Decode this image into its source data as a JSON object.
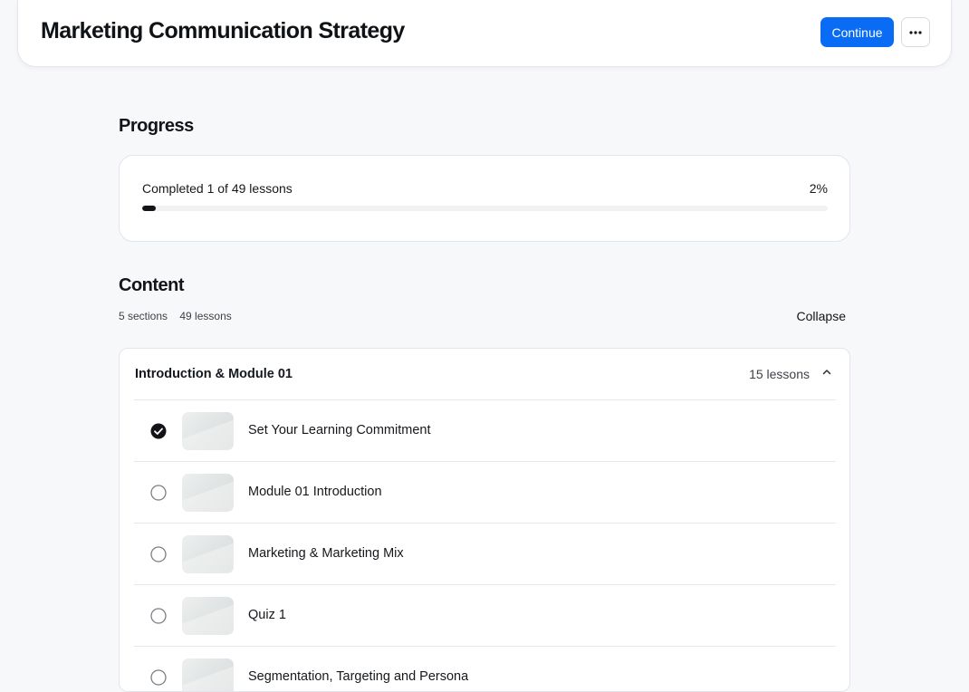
{
  "header": {
    "title": "Marketing Communication Strategy",
    "continue_label": "Continue",
    "more_icon": "more-horizontal-icon"
  },
  "progress": {
    "heading": "Progress",
    "text": "Completed 1 of 49 lessons",
    "percent_label": "2%",
    "fraction": 0.02
  },
  "content": {
    "heading": "Content",
    "sections_label": "5 sections",
    "lessons_label": "49 lessons",
    "collapse_label": "Collapse"
  },
  "section": {
    "title": "Introduction & Module 01",
    "count_label": "15 lessons",
    "expanded": true,
    "lessons": [
      {
        "title": "Set Your Learning Commitment",
        "completed": true
      },
      {
        "title": "Module 01 Introduction",
        "completed": false
      },
      {
        "title": "Marketing & Marketing Mix",
        "completed": false
      },
      {
        "title": "Quiz 1",
        "completed": false
      },
      {
        "title": "Segmentation, Targeting and Persona",
        "completed": false
      }
    ]
  },
  "colors": {
    "accent": "#0a6cf5",
    "progress_fill": "#121417",
    "background": "#f7f8fa"
  }
}
